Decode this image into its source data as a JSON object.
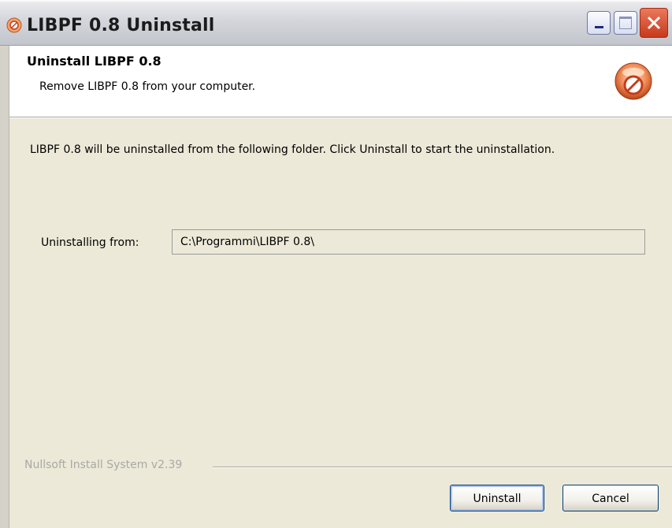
{
  "window": {
    "title": "LIBPF 0.8 Uninstall",
    "icon": "uninstall-disc-icon"
  },
  "header": {
    "title": "Uninstall LIBPF 0.8",
    "subtitle": "Remove LIBPF 0.8 from your computer.",
    "icon": "uninstall-disc-icon"
  },
  "body": {
    "intro": "LIBPF 0.8 will be uninstalled from the following folder. Click Uninstall to start the uninstallation.",
    "path_label": "Uninstalling from:",
    "path_value": "C:\\Programmi\\LIBPF 0.8\\"
  },
  "footer": {
    "branding": "Nullsoft Install System v2.39",
    "uninstall_label": "Uninstall",
    "cancel_label": "Cancel"
  },
  "colors": {
    "dialog_bg": "#ece9d8",
    "header_bg": "#ffffff",
    "close_red": "#c8391c",
    "button_border": "#003c74"
  }
}
